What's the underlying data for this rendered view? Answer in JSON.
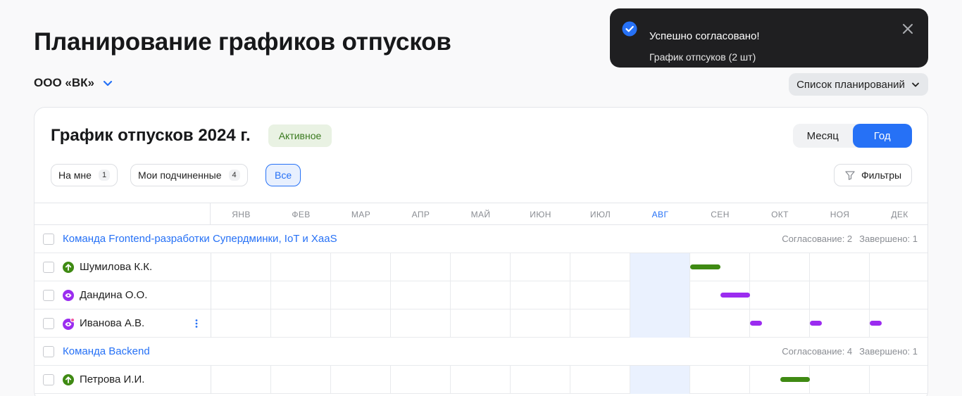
{
  "page": {
    "title": "Планирование графиков отпусков"
  },
  "company": {
    "name": "ООО «ВК»",
    "icon": "chevron-down-icon"
  },
  "plan_list_button": {
    "label": "Список планирований"
  },
  "toast": {
    "title": "Успешно согласовано!",
    "subtitle": "График отпсуков (2 шт)",
    "icon": "check-circle-icon",
    "close_icon": "close-icon"
  },
  "schedule": {
    "title": "График отпусков 2024 г.",
    "status": "Активное",
    "view_switch": {
      "month": "Месяц",
      "year": "Год",
      "selected": "year"
    },
    "filter_chips": [
      {
        "label": "На мне",
        "count": "1"
      },
      {
        "label": "Мои подчиненные",
        "count": "4"
      },
      {
        "label": "Все",
        "selected": true
      }
    ],
    "filters_button": {
      "label": "Фильтры",
      "icon": "filter-icon"
    },
    "months": [
      "ЯНВ",
      "ФЕВ",
      "МАР",
      "АПР",
      "МАЙ",
      "ИЮН",
      "ИЮЛ",
      "АВГ",
      "СЕН",
      "ОКТ",
      "НОЯ",
      "ДЕК"
    ],
    "current_month": "АВГ",
    "groups": [
      {
        "name": "Команда Frontend-разработки Супердминки, IoT и XaaS",
        "approval": "Согласование: 2",
        "completed": "Завершено: 1",
        "people": [
          {
            "name": "Шумилова К.К.",
            "icon": "arrow-up-circle-icon",
            "icon_color": "#3f8a13",
            "bars": [
              {
                "color": "green",
                "month_start": 9.0,
                "month_end": 9.5
              }
            ]
          },
          {
            "name": "Дандина О.О.",
            "icon": "eye-circle-icon",
            "icon_color": "#9b2cf0",
            "bars": [
              {
                "color": "purple",
                "month_start": 9.5,
                "month_end": 10.0
              }
            ]
          },
          {
            "name": "Иванова А.В.",
            "icon": "eye-badge-icon",
            "icon_color": "#9b2cf0",
            "has_menu": true,
            "bars": [
              {
                "color": "purple",
                "month_start": 10.0,
                "month_end": 10.2
              },
              {
                "color": "purple",
                "month_start": 11.0,
                "month_end": 11.2
              },
              {
                "color": "purple",
                "month_start": 12.0,
                "month_end": 12.2
              }
            ]
          }
        ]
      },
      {
        "name": "Команда Backend",
        "approval": "Согласование: 4",
        "completed": "Завершено: 1",
        "people": [
          {
            "name": "Петрова И.И.",
            "icon": "arrow-up-circle-icon",
            "icon_color": "#3f8a13",
            "bars": [
              {
                "color": "green",
                "month_start": 10.5,
                "month_end": 11.0
              }
            ]
          }
        ]
      }
    ]
  }
}
